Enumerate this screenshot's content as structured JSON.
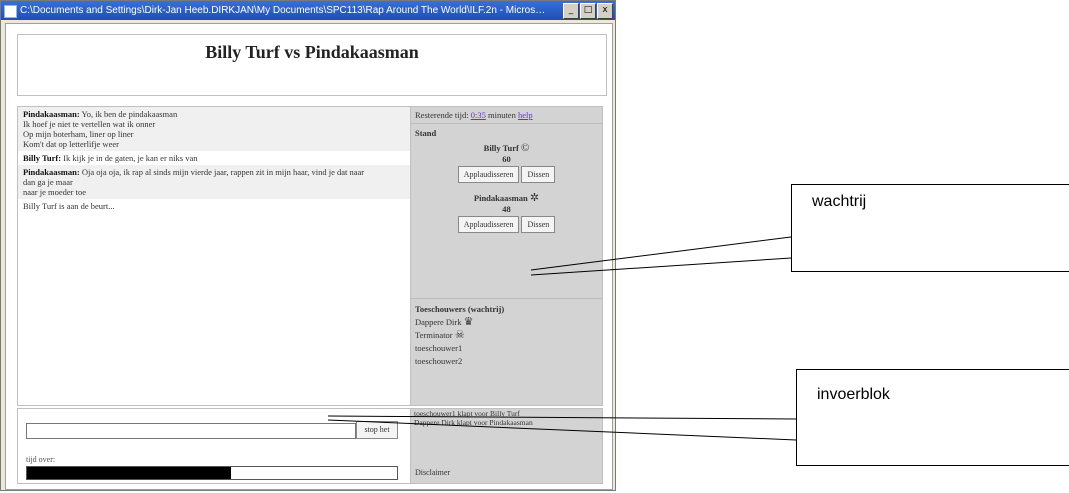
{
  "window": {
    "title": "C:\\Documents and Settings\\Dirk-Jan Heeb.DIRKJAN\\My Documents\\SPC113\\Rap Around The World\\ILF.2n - Microsoft Internet E...",
    "min": "_",
    "max": "□",
    "close": "x"
  },
  "header": {
    "title": "Billy Turf vs Pindakaasman"
  },
  "chat": {
    "messages": [
      {
        "speaker": "Pindakaasman:",
        "lines": [
          "Yo, ik ben de pindakaasman",
          "Ik hoef je niet te vertellen wat ik onner",
          "Op mijn boterham, liner op liner",
          "Kom't dat op letterlifje weer"
        ],
        "alt": true
      },
      {
        "speaker": "Billy Turf:",
        "lines": [
          "Ik kijk je in de gaten, je kan er niks van"
        ],
        "alt": false
      },
      {
        "speaker": "Pindakaasman:",
        "lines": [
          "Oja oja oja, ik rap al sinds mijn vierde jaar, rappen zit in mijn haar, vind je dat naar",
          "dan ga je maar",
          "naar je moeder toe"
        ],
        "alt": true
      },
      {
        "speaker": "",
        "lines": [
          "Billy Turf is aan de beurt..."
        ],
        "alt": false
      }
    ]
  },
  "timer": {
    "prefix": "Resterende tijd:",
    "value": "0:35",
    "suffix": "minuten",
    "help": "help"
  },
  "stand": {
    "title": "Stand",
    "players": [
      {
        "name": "Billy Turf",
        "icon": "©",
        "icon_name": "copyright-icon",
        "score": "60",
        "applaud": "Applaudisseren",
        "boo": "Dissen"
      },
      {
        "name": "Pindakaasman",
        "icon": "✲",
        "icon_name": "star-icon",
        "score": "48",
        "applaud": "Applaudisseren",
        "boo": "Dissen"
      }
    ]
  },
  "spectators": {
    "title": "Toeschouwers (wachtrij)",
    "list": [
      {
        "name": "Dappere Dirk",
        "icon": "♛",
        "icon_name": "crown-icon"
      },
      {
        "name": "Terminator",
        "icon": "☠",
        "icon_name": "skull-icon"
      },
      {
        "name": "toeschouwer1",
        "icon": "",
        "icon_name": ""
      },
      {
        "name": "toeschouwer2",
        "icon": "",
        "icon_name": ""
      }
    ]
  },
  "input": {
    "value": "",
    "send": "stop het"
  },
  "time_left": {
    "label": "tijd over:",
    "progress": 0.55
  },
  "log": {
    "entries": [
      "toeschouwer1 klapt voor Billy Turf",
      "Dappere Dirk klapt voor Pindakaasman"
    ],
    "disclaimer": "Disclaimer"
  },
  "callouts": {
    "wachtrij": "wachtrij",
    "invoerblok": "invoerblok"
  }
}
